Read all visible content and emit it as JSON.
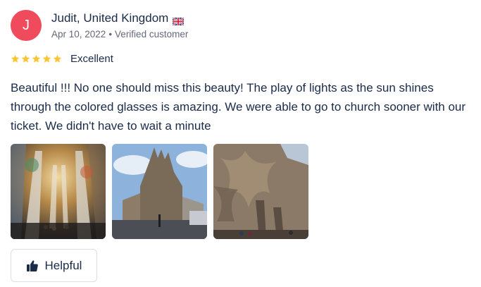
{
  "review": {
    "avatar_initial": "J",
    "author": "Judit, United Kingdom",
    "date": "Apr 10, 2022",
    "separator": "•",
    "verified_label": "Verified customer",
    "rating_value": 5,
    "rating_max": 5,
    "rating_label": "Excellent",
    "text": "Beautiful !!! No one should miss this beauty! The play of lights as the sun shines through the colored glasses is amazing. We were able to go to church sooner with our ticket. We didn't have to wait a minute",
    "helpful_label": "Helpful"
  },
  "icons": {
    "flag": "uk-flag-icon",
    "star": "star-icon",
    "thumb": "thumbs-up-icon"
  },
  "colors": {
    "avatar_bg": "#ef4b5c",
    "star": "#fdc432",
    "text": "#1a2b49",
    "meta": "#63687a"
  }
}
